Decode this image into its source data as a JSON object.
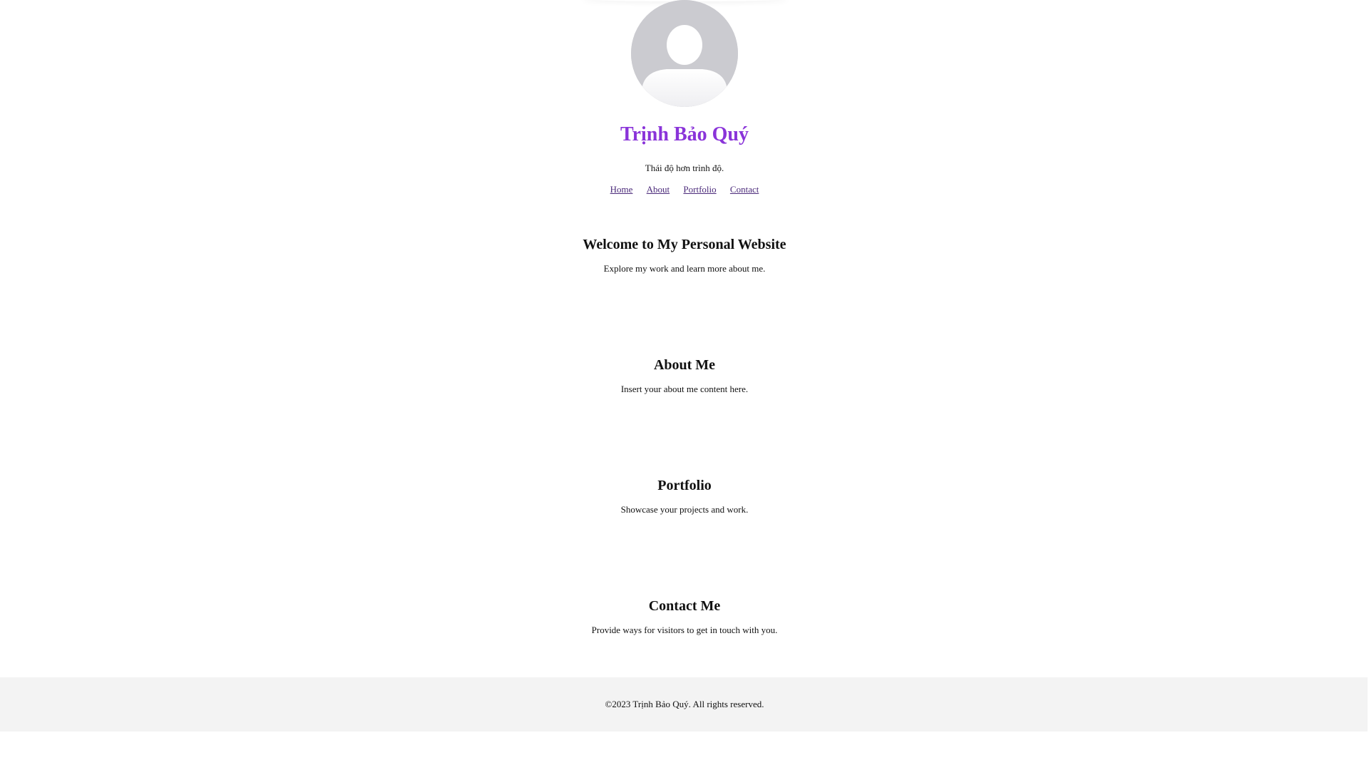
{
  "header": {
    "avatar_icon": "user-silhouette-icon",
    "name": "Trịnh Bảo Quý",
    "tagline": "Thái độ hơn trình độ."
  },
  "nav": {
    "items": [
      {
        "label": "Home"
      },
      {
        "label": "About"
      },
      {
        "label": "Portfolio"
      },
      {
        "label": "Contact"
      }
    ]
  },
  "sections": {
    "home": {
      "title": "Welcome to My Personal Website",
      "text": "Explore my work and learn more about me."
    },
    "about": {
      "title": "About Me",
      "text": "Insert your about me content here."
    },
    "portfolio": {
      "title": "Portfolio",
      "text": "Showcase your projects and work."
    },
    "contact": {
      "title": "Contact Me",
      "text": "Provide ways for visitors to get in touch with you."
    }
  },
  "footer": {
    "text": "©2023 Trịnh Bảo Quý. All rights reserved."
  },
  "colors": {
    "name_accent": "#8a34d9",
    "link": "#4b2a7a",
    "footer_bg": "#f3f3f3",
    "avatar_bg": "#cbcbd0"
  }
}
